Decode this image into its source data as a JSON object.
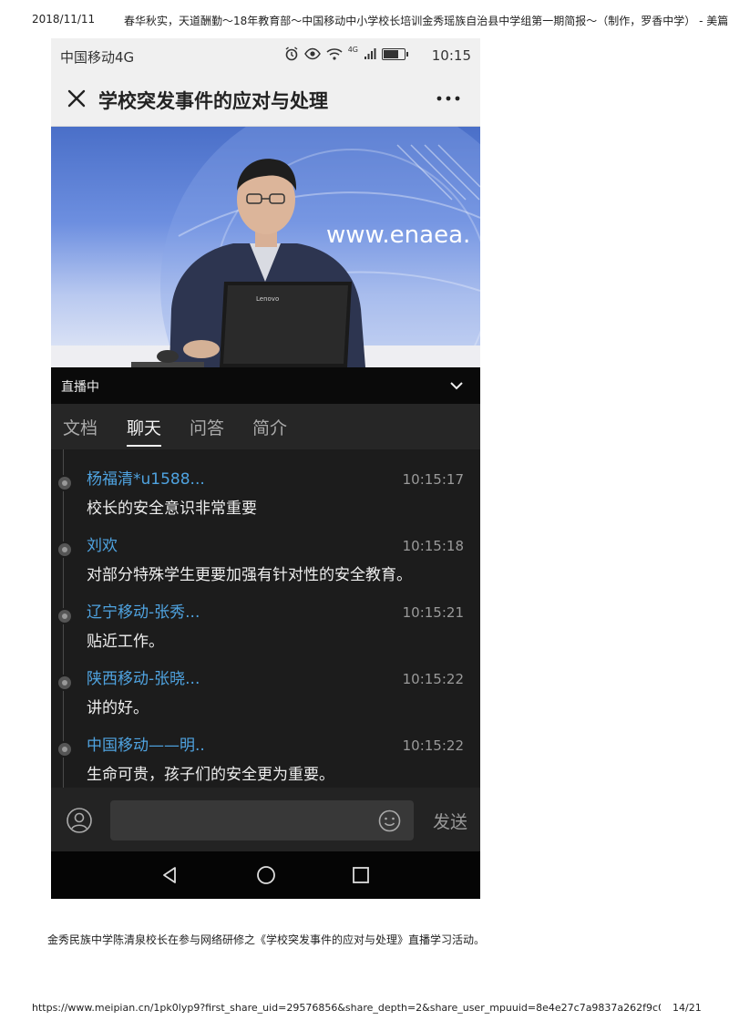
{
  "print_header": {
    "date": "2018/11/11",
    "title": "春华秋实，天道酬勤～18年教育部～中国移动中小学校长培训金秀瑶族自治县中学组第一期简报～（制作，罗香中学） - 美篇"
  },
  "status_bar": {
    "carrier": "中国移动4G",
    "network": "4G",
    "time": "10:15"
  },
  "navbar": {
    "title": "学校突发事件的应对与处理"
  },
  "video": {
    "backdrop_text": "www.enaea.",
    "laptop_brand": "Lenovo"
  },
  "live_bar": {
    "label": "直播中"
  },
  "tabs": [
    {
      "label": "文档",
      "active": false
    },
    {
      "label": "聊天",
      "active": true
    },
    {
      "label": "问答",
      "active": false
    },
    {
      "label": "简介",
      "active": false
    }
  ],
  "chat": {
    "messages": [
      {
        "user": "杨福清*u1588...",
        "time": "10:15:17",
        "text": "校长的安全意识非常重要"
      },
      {
        "user": "刘欢",
        "time": "10:15:18",
        "text": "对部分特殊学生更要加强有针对性的安全教育。"
      },
      {
        "user": "辽宁移动-张秀...",
        "time": "10:15:21",
        "text": "贴近工作。"
      },
      {
        "user": "陕西移动-张晓...",
        "time": "10:15:22",
        "text": "讲的好。"
      },
      {
        "user": "中国移动——明..",
        "time": "10:15:22",
        "text": "生命可贵，孩子们的安全更为重要。"
      }
    ]
  },
  "input_bar": {
    "placeholder": "",
    "send_label": "发送"
  },
  "caption": "金秀民族中学陈清泉校长在参与网络研修之《学校突发事件的应对与处理》直播学习活动。",
  "print_footer": {
    "url": "https://www.meipian.cn/1pk0lyp9?first_share_uid=29576856&share_depth=2&share_user_mpuuid=8e4e27c7a9837a262f9c0667930d9de8&us...",
    "page": "14/21"
  },
  "colors": {
    "username_blue": "#4fa3e0",
    "chat_bg": "#1c1c1c",
    "header_bg": "#f0f0f0"
  }
}
